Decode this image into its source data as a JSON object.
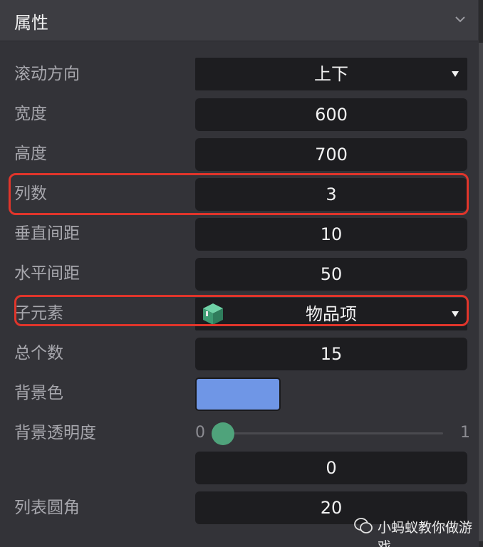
{
  "header": {
    "title": "属性"
  },
  "rows": {
    "scroll_direction": {
      "label": "滚动方向",
      "value": "上下"
    },
    "width": {
      "label": "宽度",
      "value": "600"
    },
    "height": {
      "label": "高度",
      "value": "700"
    },
    "columns": {
      "label": "列数",
      "value": "3"
    },
    "vertical_spacing": {
      "label": "垂直间距",
      "value": "10"
    },
    "horizontal_spacing": {
      "label": "水平间距",
      "value": "50"
    },
    "child_element": {
      "label": "子元素",
      "value": "物品项"
    },
    "total_count": {
      "label": "总个数",
      "value": "15"
    },
    "bg_color": {
      "label": "背景色",
      "value": "#6f96e6"
    },
    "bg_opacity": {
      "label": "背景透明度",
      "min": "0",
      "max": "1",
      "value": "0",
      "level": 0
    },
    "list_radius": {
      "label": "列表圆角",
      "value": "20"
    }
  },
  "watermark": {
    "text": "小蚂蚁教你做游戏"
  },
  "colors": {
    "highlight": "#e0352b",
    "slider_knob": "#4fa37b",
    "swatch": "#6f96e6"
  }
}
